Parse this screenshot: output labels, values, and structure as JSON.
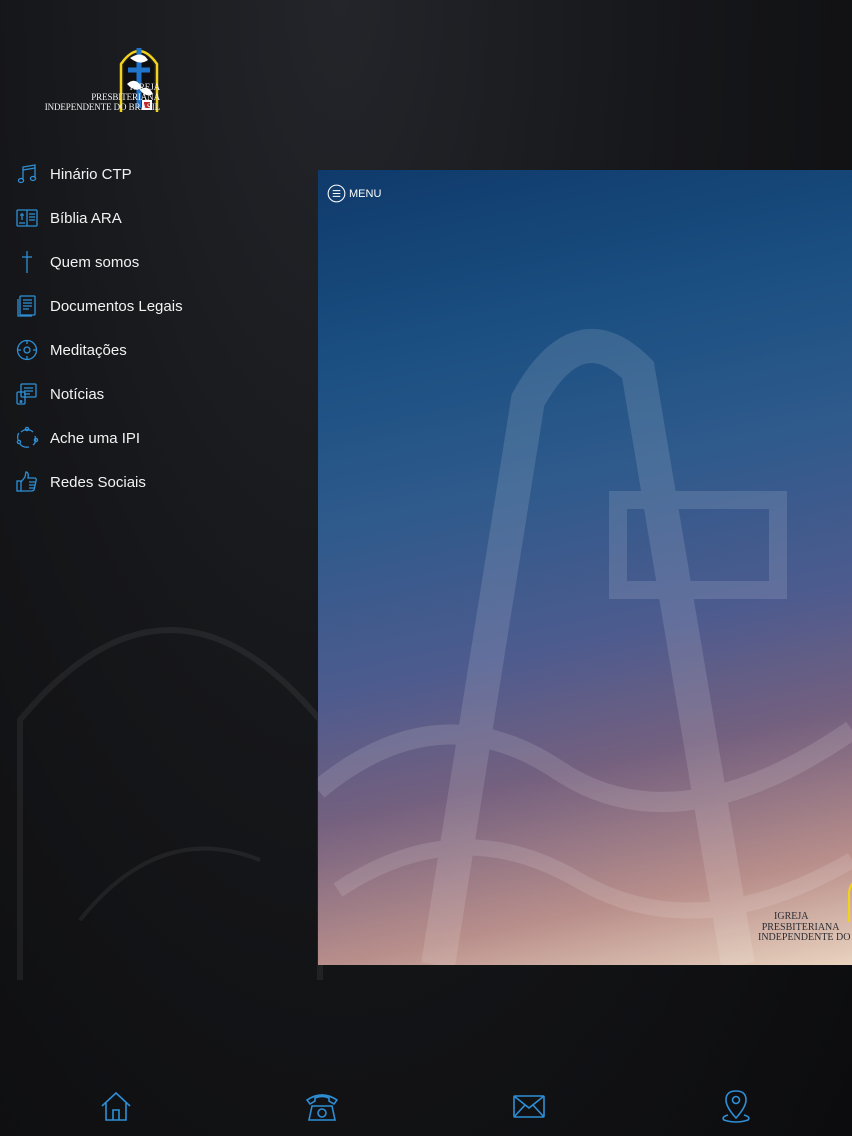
{
  "logo": {
    "line1": "IGREJA",
    "line2": "PRESBITERIANA",
    "line3": "INDEPENDENTE DO BRASIL"
  },
  "menu": {
    "items": [
      {
        "label": "Hinário CTP",
        "icon": "music-note-icon"
      },
      {
        "label": "Bíblia ARA",
        "icon": "bible-icon"
      },
      {
        "label": "Quem somos",
        "icon": "cross-icon"
      },
      {
        "label": "Documentos Legais",
        "icon": "document-icon"
      },
      {
        "label": "Meditações",
        "icon": "compass-icon"
      },
      {
        "label": "Notícias",
        "icon": "news-device-icon"
      },
      {
        "label": "Ache uma IPI",
        "icon": "network-icon"
      },
      {
        "label": "Redes Sociais",
        "icon": "thumbs-up-icon"
      }
    ]
  },
  "panel": {
    "menu_toggle_label": "MENU",
    "logo": {
      "line1": "IGREJA",
      "line2": "PRESBITERIANA",
      "line3": "INDEPENDENTE DO"
    }
  },
  "tabs": [
    {
      "icon": "home-icon"
    },
    {
      "icon": "phone-icon"
    },
    {
      "icon": "mail-icon"
    },
    {
      "icon": "location-pin-icon"
    }
  ],
  "colors": {
    "accent_icon": "#2e8fd6",
    "logo_yellow": "#f2d21b",
    "logo_blue": "#1f73c9"
  }
}
